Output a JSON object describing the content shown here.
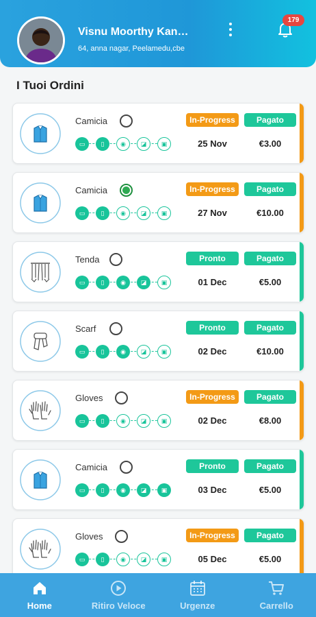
{
  "header": {
    "user_name": "Visnu Moorthy Kan…",
    "address": "64, anna nagar, Peelamedu,cbe",
    "notification_count": "179"
  },
  "section_title": "I Tuoi Ordini",
  "colors": {
    "brand_blue": "#1f97d8",
    "in_progress": "#f39a16",
    "ready_paid": "#1ec79a",
    "badge_red": "#e8463f"
  },
  "orders": [
    {
      "item": "Camicia",
      "icon": "shirt-icon",
      "selected": false,
      "status": "In-Progress",
      "payment": "Pagato",
      "date": "25 Nov",
      "price": "€3.00",
      "progress": 0.25
    },
    {
      "item": "Camicia",
      "icon": "shirt-icon",
      "selected": true,
      "status": "In-Progress",
      "payment": "Pagato",
      "date": "27 Nov",
      "price": "€10.00",
      "progress": 0.25
    },
    {
      "item": "Tenda",
      "icon": "curtain-icon",
      "selected": false,
      "status": "Pronto",
      "payment": "Pagato",
      "date": "01 Dec",
      "price": "€5.00",
      "progress": 0.75
    },
    {
      "item": "Scarf",
      "icon": "scarf-icon",
      "selected": false,
      "status": "Pronto",
      "payment": "Pagato",
      "date": "02 Dec",
      "price": "€10.00",
      "progress": 0.5
    },
    {
      "item": "Gloves",
      "icon": "gloves-icon",
      "selected": false,
      "status": "In-Progress",
      "payment": "Pagato",
      "date": "02 Dec",
      "price": "€8.00",
      "progress": 0.25
    },
    {
      "item": "Camicia",
      "icon": "shirt-icon",
      "selected": false,
      "status": "Pronto",
      "payment": "Pagato",
      "date": "03 Dec",
      "price": "€5.00",
      "progress": 1.0
    },
    {
      "item": "Gloves",
      "icon": "gloves-icon",
      "selected": false,
      "status": "In-Progress",
      "payment": "Pagato",
      "date": "05 Dec",
      "price": "€5.00",
      "progress": 0.25
    }
  ],
  "tabs": [
    {
      "label": "Home",
      "icon": "home-icon",
      "active": true
    },
    {
      "label": "Ritiro Veloce",
      "icon": "play-circle-icon",
      "active": false
    },
    {
      "label": "Urgenze",
      "icon": "calendar-icon",
      "active": false
    },
    {
      "label": "Carrello",
      "icon": "cart-icon",
      "active": false
    }
  ]
}
